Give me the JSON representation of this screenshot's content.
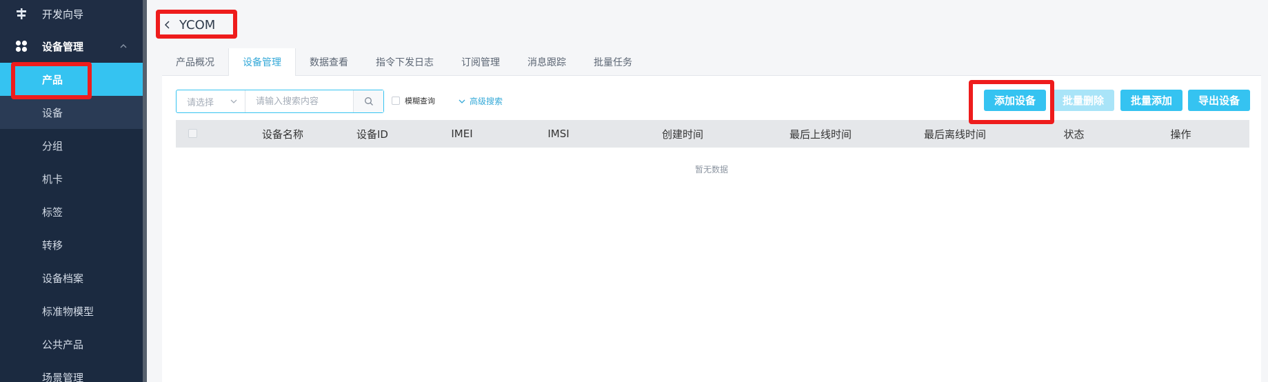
{
  "sidebar": {
    "top_item": "开发向导",
    "group": "设备管理",
    "items": [
      {
        "label": "产品",
        "active": true
      },
      {
        "label": "设备"
      },
      {
        "label": "分组"
      },
      {
        "label": "机卡"
      },
      {
        "label": "标签"
      },
      {
        "label": "转移"
      },
      {
        "label": "设备档案"
      },
      {
        "label": "标准物模型"
      },
      {
        "label": "公共产品"
      },
      {
        "label": "场景管理"
      }
    ]
  },
  "header": {
    "back_title": "YCOM"
  },
  "tabs": [
    {
      "label": "产品概况"
    },
    {
      "label": "设备管理",
      "active": true
    },
    {
      "label": "数据查看"
    },
    {
      "label": "指令下发日志"
    },
    {
      "label": "订阅管理"
    },
    {
      "label": "消息跟踪"
    },
    {
      "label": "批量任务"
    }
  ],
  "search": {
    "select_placeholder": "请选择",
    "input_placeholder": "请输入搜索内容",
    "fuzzy_label": "模糊查询",
    "advanced_label": "高级搜索"
  },
  "actions": {
    "add": "添加设备",
    "batch_delete": "批量删除",
    "batch_add": "批量添加",
    "export": "导出设备"
  },
  "table": {
    "columns": [
      "设备名称",
      "设备ID",
      "IMEI",
      "IMSI",
      "创建时间",
      "最后上线时间",
      "最后离线时间",
      "状态",
      "操作"
    ],
    "empty_text": "暂无数据"
  },
  "colors": {
    "accent": "#35c3f1",
    "sidebar_bg": "#1f2d44",
    "highlight": "#ee1c1c"
  }
}
